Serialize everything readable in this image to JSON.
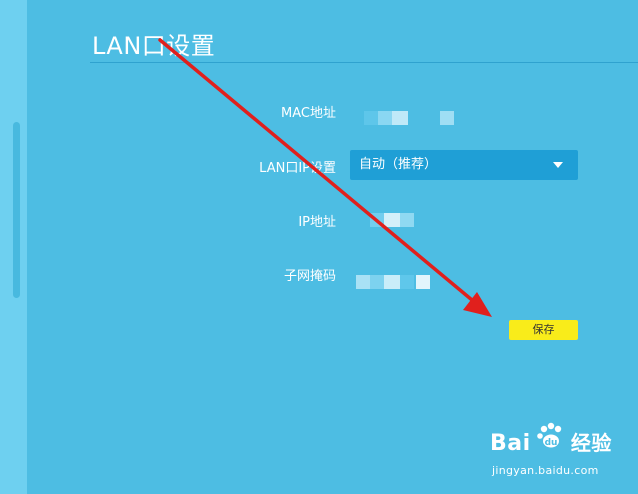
{
  "page": {
    "title": "LAN口设置"
  },
  "form": {
    "mac_label": "MAC地址",
    "lan_mode_label": "LAN口IP设置",
    "lan_mode_value": "自动（推荐）",
    "ip_label": "IP地址",
    "mask_label": "子网掩码",
    "save_label": "保存"
  },
  "watermark": {
    "brand": "Bai",
    "brand_cn": "经验",
    "url": "jingyan.baidu.com"
  },
  "colors": {
    "background": "#4dbde3",
    "select_bg": "#1f9fd6",
    "save_button": "#f9ec1a",
    "arrow": "#e0201d"
  }
}
